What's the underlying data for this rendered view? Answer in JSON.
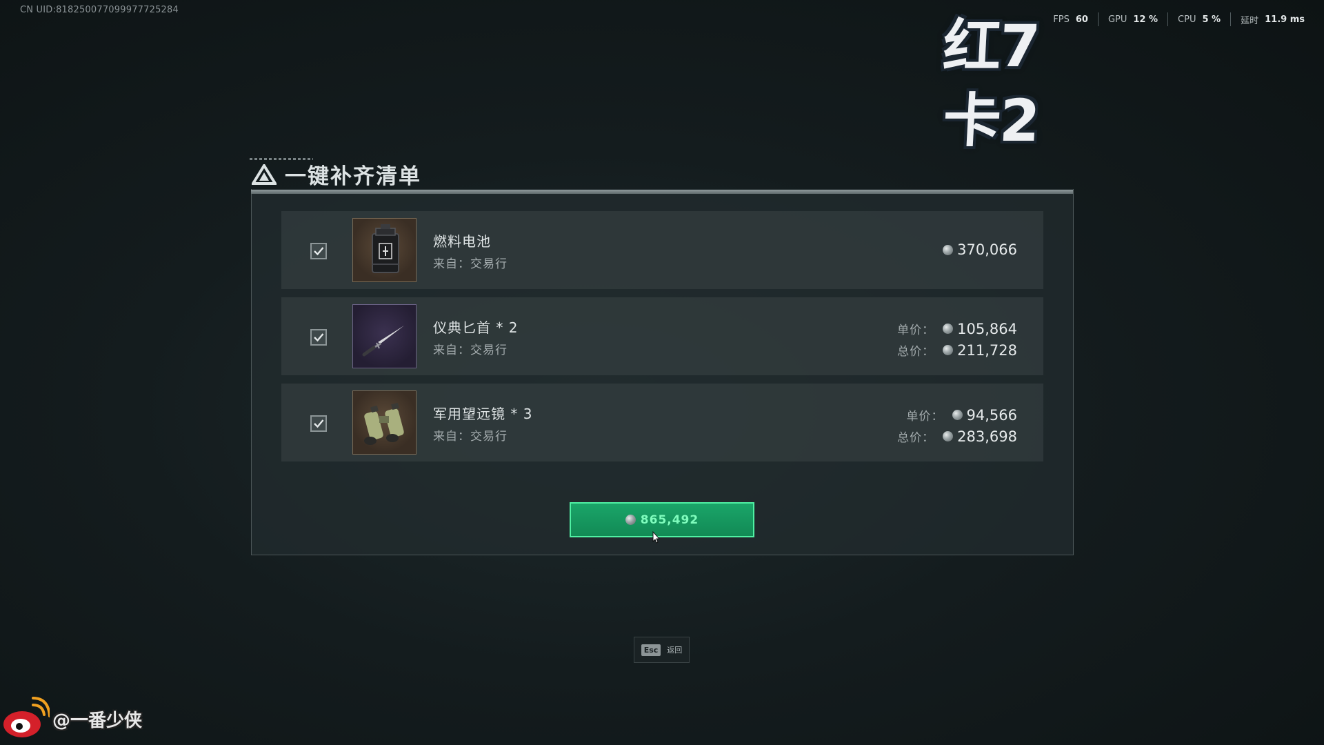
{
  "uid": "CN UID:818250077099977725284",
  "perf": {
    "fps_label": "FPS",
    "fps_value": "60",
    "gpu_label": "GPU",
    "gpu_value": "12 %",
    "cpu_label": "CPU",
    "cpu_value": "5 %",
    "latency_label": "延时",
    "latency_value": "11.9 ms"
  },
  "overlay_text": {
    "line1": "红7",
    "line2": "卡2"
  },
  "panel": {
    "title": "一键补齐清单"
  },
  "items": [
    {
      "name": "燃料电池",
      "source": "来自：交易行",
      "price": "370,066",
      "checked": true,
      "icon": "fuel-cell-icon"
    },
    {
      "name": "仪典匕首 * 2",
      "source": "来自：交易行",
      "unit_label": "单价：",
      "unit_price": "105,864",
      "total_label": "总价：",
      "total_price": "211,728",
      "checked": true,
      "icon": "dagger-icon"
    },
    {
      "name": "军用望远镜 * 3",
      "source": "来自：交易行",
      "unit_label": "单价：",
      "unit_price": "94,566",
      "total_label": "总价：",
      "total_price": "283,698",
      "checked": true,
      "icon": "binoculars-icon"
    }
  ],
  "buy_button": {
    "total": "865,492"
  },
  "esc": {
    "key": "Esc",
    "label": "返回"
  },
  "watermark": {
    "handle": "@一番少侠"
  },
  "colors": {
    "accent_green": "#1aa569",
    "button_border": "#4ff0a3",
    "button_text": "#7ffcbd"
  }
}
